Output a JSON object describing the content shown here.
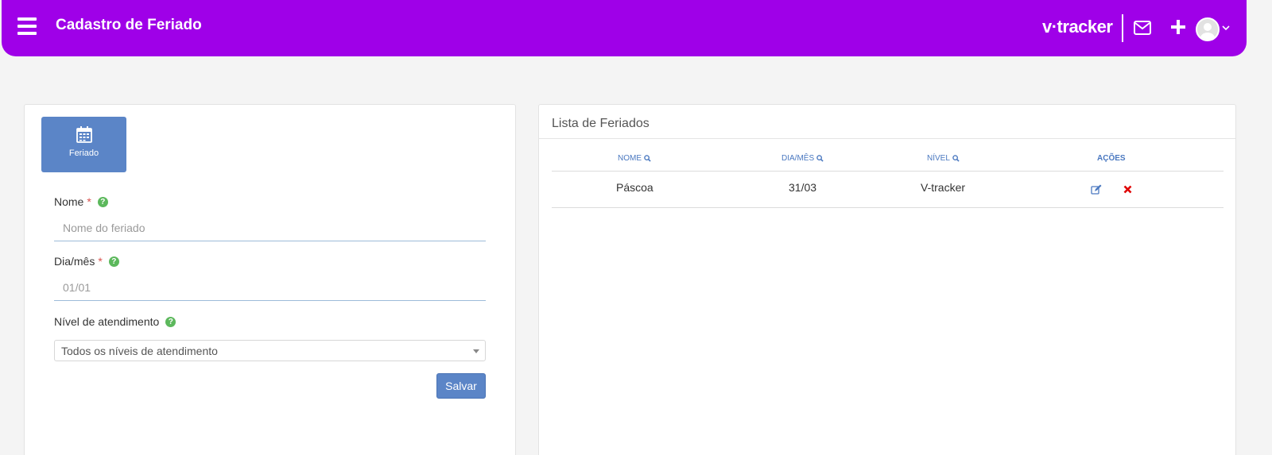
{
  "header": {
    "title": "Cadastro de Feriado",
    "brand": "v·tracker",
    "icons": {
      "menu": "hamburger-menu-icon",
      "mail": "mail-icon",
      "add": "plus-icon",
      "user": "avatar",
      "dropdown": "chevron-down-icon"
    },
    "bg_color": "#9f00e8"
  },
  "form": {
    "tile_label": "Feriado",
    "tile_icon": "calendar-icon",
    "name_label": "Nome",
    "name_placeholder": "Nome do feriado",
    "date_label": "Dia/mês",
    "date_placeholder": "01/01",
    "level_label": "Nível de atendimento",
    "level_selected": "Todos os níveis de atendimento",
    "required_mark": "*",
    "help_glyph": "?",
    "save_label": "Salvar"
  },
  "list": {
    "title": "Lista de Feriados",
    "columns": [
      {
        "label": "NOME",
        "searchable": true
      },
      {
        "label": "DIA/MÊS",
        "searchable": true
      },
      {
        "label": "NÍVEL",
        "searchable": true
      },
      {
        "label": "AÇÕES",
        "searchable": false
      }
    ],
    "rows": [
      {
        "name": "Páscoa",
        "date": "31/03",
        "level": "V-tracker",
        "actions": [
          "edit-icon",
          "delete-icon"
        ]
      }
    ]
  },
  "colors": {
    "accent": "#5b85c7",
    "link": "#4a78c0",
    "help": "#5cb85c",
    "required": "#d9534f",
    "delete": "#e00000"
  }
}
